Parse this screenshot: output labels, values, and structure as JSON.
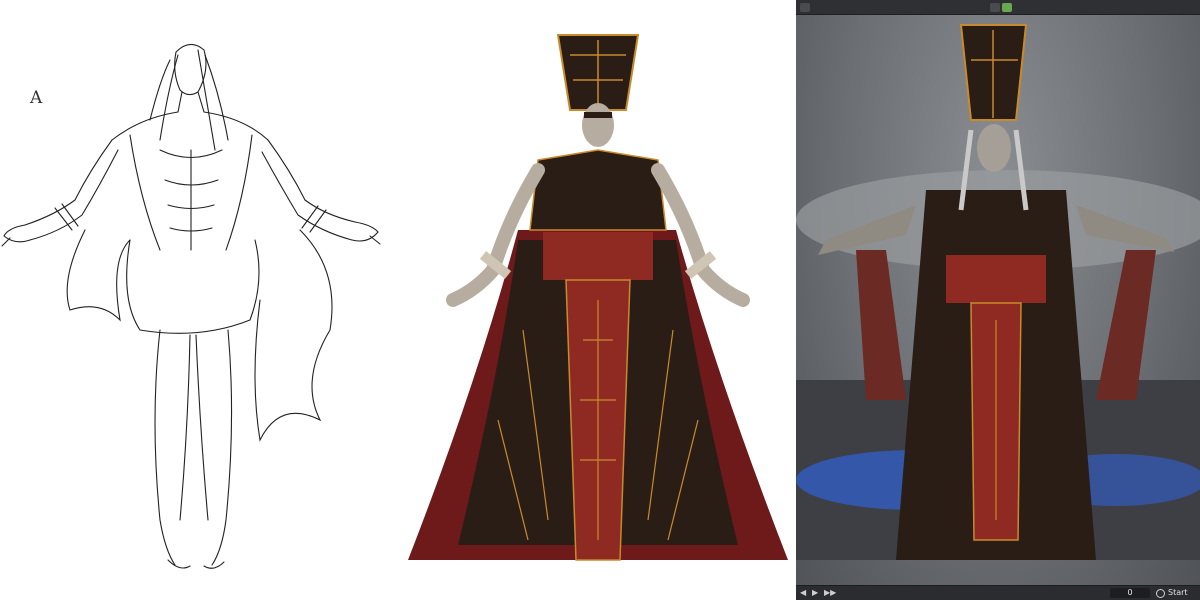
{
  "sketch_panel": {
    "sheet_letter": "A"
  },
  "viewport": {
    "playback_icons": [
      "jump-start-icon",
      "play-icon",
      "jump-end-icon"
    ],
    "current_frame": "0",
    "start_label": "Start"
  },
  "colors": {
    "robe_dark": "#2a1d16",
    "robe_red": "#7a1f1c",
    "sash_red": "#8e2a22",
    "gold_trim": "#c98a2c",
    "skin": "#b7aca0",
    "cloth_wrap": "#cfc5b4",
    "viewport_bg": "#6b6e72",
    "floor_glow": "#2f6bff"
  }
}
